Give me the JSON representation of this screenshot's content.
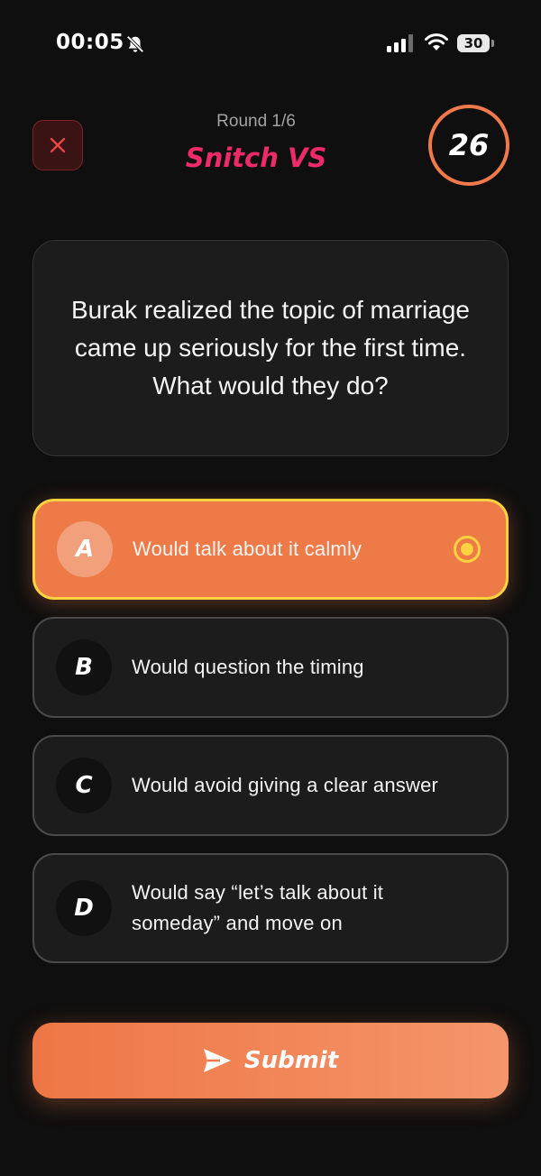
{
  "status_bar": {
    "time": "00:05",
    "battery": "30",
    "icons": [
      "bell-slash-icon",
      "cellular-signal-icon",
      "wifi-icon",
      "battery-icon"
    ]
  },
  "header": {
    "close_icon": "close-icon",
    "round_label": "Round 1/6",
    "mode_title": "Snitch VS",
    "timer": "26"
  },
  "question": {
    "text": "Burak realized the topic of marriage came up seriously for the first time. What would they do?"
  },
  "options": [
    {
      "letter": "A",
      "text": "Would talk about it calmly",
      "selected": true
    },
    {
      "letter": "B",
      "text": "Would question the timing",
      "selected": false
    },
    {
      "letter": "C",
      "text": "Would avoid giving a clear answer",
      "selected": false
    },
    {
      "letter": "D",
      "text": "Would say “let’s talk about it someday” and move on",
      "selected": false
    }
  ],
  "submit": {
    "label": "Submit",
    "icon": "send-icon"
  },
  "colors": {
    "background": "#0f0f0f",
    "accent": "#ee7a48",
    "selected_border": "#ffd23f",
    "title": "#ee2b69",
    "close_bg": "#3a1414"
  }
}
